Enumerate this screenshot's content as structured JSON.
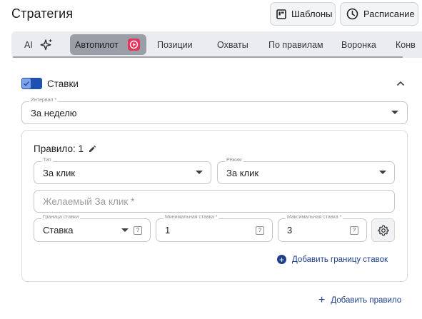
{
  "page": {
    "title": "Стратегия"
  },
  "header_buttons": {
    "templates": "Шаблоны",
    "schedule": "Расписание"
  },
  "tabs": [
    {
      "label": "AI",
      "icon": "sparkle-icon"
    },
    {
      "label": "Автопилот",
      "active": true,
      "icon": "play-badge-icon"
    },
    {
      "label": "Позиции"
    },
    {
      "label": "Охваты"
    },
    {
      "label": "По правилам"
    },
    {
      "label": "Воронка"
    },
    {
      "label": "Конв"
    }
  ],
  "section": {
    "title": "Ставки",
    "enabled": true
  },
  "interval": {
    "label": "Интервал *",
    "value": "За неделю"
  },
  "rule": {
    "title": "Правило: 1",
    "type": {
      "label": "Тип",
      "value": "За клик"
    },
    "mode": {
      "label": "Режим",
      "value": "За клик"
    },
    "desired": {
      "placeholder": "Желаемый За клик *"
    },
    "bound": {
      "label": "Граница ставки",
      "value": "Ставка"
    },
    "min": {
      "label": "Минимальная ставка *",
      "value": "1"
    },
    "max": {
      "label": "Максимальная ставка *",
      "value": "3"
    },
    "help_glyph": "?",
    "add_bound_label": "Добавить границу ставок"
  },
  "add_rule_label": "Добавить правило",
  "colors": {
    "accent": "#1e50b4",
    "link": "#1e3f8a",
    "badge": "#e6345a"
  }
}
